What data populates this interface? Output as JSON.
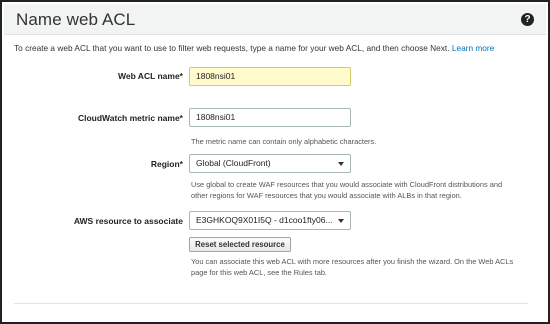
{
  "header": {
    "title": "Name web ACL",
    "help_icon": "question-circle-icon"
  },
  "intro": {
    "text": "To create a web ACL that you want to use to filter web requests, type a name for your web ACL, and then choose Next.",
    "learn_more": "Learn more"
  },
  "form": {
    "web_acl_name": {
      "label": "Web ACL name*",
      "value": "1808nsi01"
    },
    "cloudwatch_metric": {
      "label": "CloudWatch metric name*",
      "value": "1808nsi01",
      "hint": "The metric name can contain only alphabetic characters."
    },
    "region": {
      "label": "Region*",
      "value": "Global (CloudFront)",
      "hint_lines": [
        "Use global to create WAF resources that you would associate with CloudFront distributions and",
        "other regions for WAF resources that you would associate with ALBs in that region."
      ]
    },
    "aws_resource": {
      "label": "AWS resource to associate",
      "value": "E3GHKOQ9X01I5Q - d1coo1fty06...",
      "reset_label": "Reset selected resource",
      "hint_lines": [
        "You can associate this web ACL with more resources after you finish the wizard. On the Web ACLs",
        "page for this web ACL, see the Rules tab."
      ]
    }
  },
  "colors": {
    "link": "#0073bb",
    "highlight": "#fffbcc",
    "header_bg": "#f2f3f3"
  }
}
